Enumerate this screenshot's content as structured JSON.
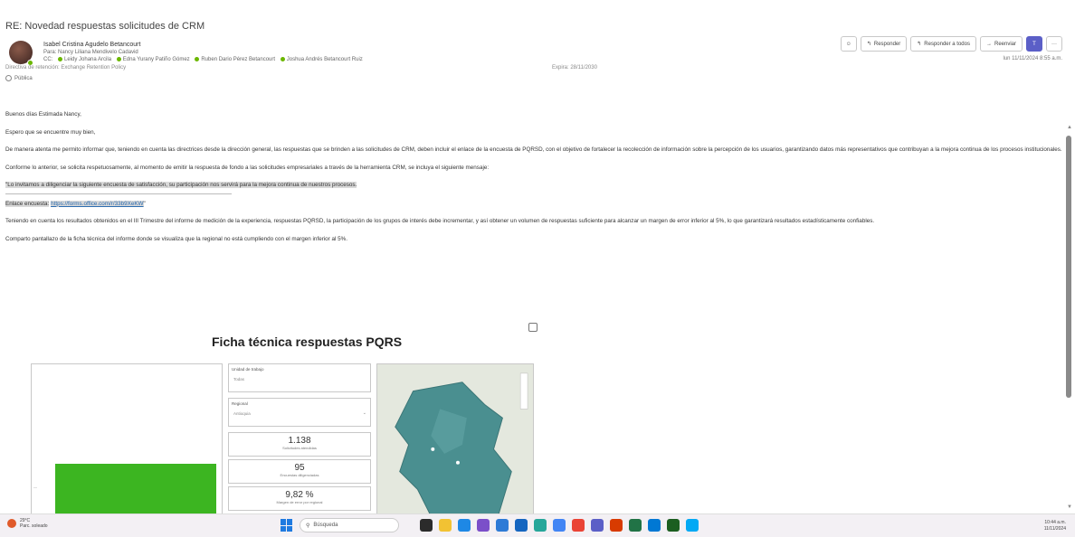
{
  "email": {
    "subject": "RE: Novedad respuestas solicitudes de CRM",
    "sender": "Isabel Cristina Agudelo Betancourt",
    "to_label": "Para:",
    "to": "Nancy Liliana Mendivelo Cadavid",
    "cc_label": "CC:",
    "cc": [
      "Leidy Johana Arcila",
      "Edna Yurany Patiño Gómez",
      "Ruben Dario Pérez Betancourt",
      "Joshua Andrés Betancourt Ruiz"
    ],
    "policy": "Directiva de retención: Exchange Retention Policy",
    "expires": "Expira: 28/11/2030",
    "flag_label": "Pública",
    "date": "lun 11/11/2024 8:55 a.m."
  },
  "actions": {
    "emoji": "☺",
    "reply": "Responder",
    "reply_all": "Responder a todos",
    "forward": "Reenviar",
    "teams": "T",
    "more": "···"
  },
  "body": {
    "greeting": "Buenos días Estimada Nancy,",
    "p1": "Espero que se encuentre muy bien,",
    "p2": "De manera atenta me permito informar que, teniendo en cuenta las directrices desde la dirección general, las respuestas que se brinden a las solicitudes de CRM, deben incluir el enlace de la encuesta de PQRSD, con el objetivo de fortalecer la recolección de información sobre la percepción de los usuarios, garantizando datos más representativos que contribuyan a la mejora continua de los procesos institucionales.",
    "p3": "Conforme lo anterior, se solicita respetuosamente, al momento de emitir la respuesta de fondo a las solicitudes empresariales a través de la herramienta CRM, se incluya el siguiente mensaje:",
    "quote": "\"Lo invitamos a diligenciar la siguiente encuesta de satisfacción, su participación nos servirá para la mejora continua de nuestros procesos.",
    "link_label": "Enlace encuesta:",
    "link": "https://forms.office.com/r/33b9XeKW",
    "link_close": "\"",
    "p4": "Teniendo en cuenta los resultados obtenidos en el III Trimestre del informe de medición de la experiencia, respuestas PQRSD, la participación de los grupos de interés debe incrementar, y así obtener un volumen de respuestas suficiente para alcanzar un margen de error inferior al 5%, lo que garantizará resultados estadísticamente confiables.",
    "p5": "Comparto pantallazo de la ficha técnica del informe donde se visualiza que la regional no está cumpliendo con el margen inferior al 5%."
  },
  "figure": {
    "title": "Ficha técnica respuestas PQRS",
    "filter1_label": "Unidad de trabajo",
    "filter1_value": "Todas",
    "filter2_label": "Regional",
    "filter2_value": "Antioquia",
    "kpis": [
      {
        "value": "1.138",
        "caption": "Solicitudes atendidas"
      },
      {
        "value": "95",
        "caption": "Encuestas diligenciadas"
      },
      {
        "value": "9,82 %",
        "caption": "Margen de error por regional"
      }
    ]
  },
  "taskbar": {
    "weather_temp": "29°C",
    "weather_desc": "Parc. soleado",
    "search_placeholder": "Búsqueda",
    "time": "10:44 a.m.",
    "date": "11/11/2024"
  },
  "colors": {
    "accent": "#1f7ae0",
    "bar_green": "#3cb521",
    "presence_green": "#6bb700",
    "teams_purple": "#5b5fc7",
    "map_region": "#4a8f90"
  }
}
